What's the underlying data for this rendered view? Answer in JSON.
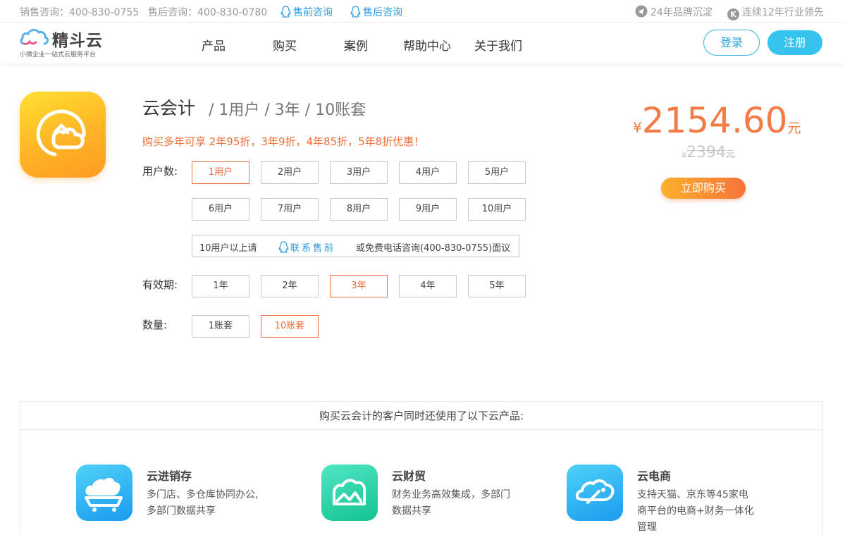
{
  "topbar": {
    "presale_phone": "销售咨询：400-830-0755",
    "aftersale_phone": "售后咨询：400-830-0780",
    "presale_qq": "售前咨询",
    "aftersale_qq": "售后咨询",
    "brand_years": "24年品牌沉淀",
    "industry_lead": "连续12年行业领先"
  },
  "nav": {
    "logo_name": "精斗云",
    "logo_slogan": "小微企业一站式云服务平台",
    "menu": [
      "产品",
      "购买",
      "案例",
      "帮助中心",
      "关于我们"
    ],
    "login": "登录",
    "register": "注册"
  },
  "product": {
    "name": "云会计",
    "spec": "/ 1用户 / 3年 / 10账套",
    "promo": "购买多年可享 2年95折，3年9折，4年85折，5年8折优惠！",
    "users_label": "用户数:",
    "users": [
      "1用户",
      "2用户",
      "3用户",
      "4用户",
      "5用户",
      "6用户",
      "7用户",
      "8用户",
      "9用户",
      "10用户"
    ],
    "users_selected": 0,
    "more_users_prefix": "10用户以上请",
    "more_users_link": "联系售前",
    "more_users_suffix": "或免费电话咨询(400-830-0755)面议",
    "period_label": "有效期:",
    "periods": [
      "1年",
      "2年",
      "3年",
      "4年",
      "5年"
    ],
    "period_selected": 2,
    "qty_label": "数量:",
    "qtys": [
      "1账套",
      "10账套"
    ],
    "qty_selected": 1
  },
  "price": {
    "currency": "¥",
    "value": "2154.60",
    "unit": "元",
    "old_currency": "¥",
    "old_value": "2394",
    "old_unit": "元",
    "buy_label": "立即购买",
    "accent": "#f47a46"
  },
  "related": {
    "heading": "购买云会计的客户同时还使用了以下云产品:",
    "items": [
      {
        "name": "云进销存",
        "desc": "多门店、多仓库协同办公,多部门数据共享",
        "icon": "cloud-cart-icon"
      },
      {
        "name": "云财贸",
        "desc": "财务业务高效集成，多部门数据共享",
        "icon": "cloud-chart-icon"
      },
      {
        "name": "云电商",
        "desc": "支持天猫、京东等45家电商平台的电商+财务一体化管理",
        "icon": "price-tag-icon"
      }
    ]
  }
}
